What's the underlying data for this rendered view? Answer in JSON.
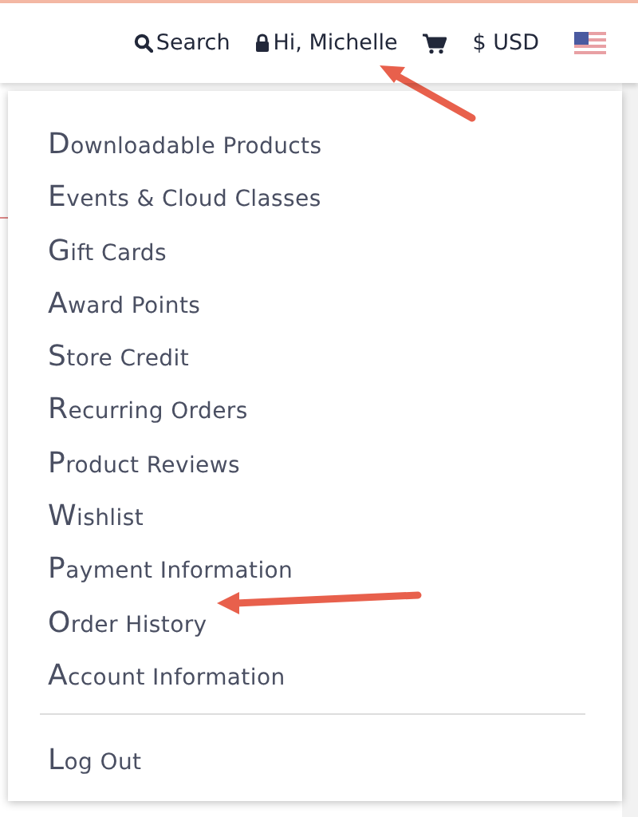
{
  "header": {
    "search": "Search",
    "greeting": "Hi, Michelle",
    "currency": "$ USD"
  },
  "menu": {
    "items": [
      "Downloadable Products",
      "Events & Cloud Classes",
      "Gift Cards",
      "Award Points",
      "Store Credit",
      "Recurring Orders",
      "Product Reviews",
      "Wishlist",
      "Payment Information",
      "Order History",
      "Account Information"
    ],
    "logout": "Log Out"
  }
}
